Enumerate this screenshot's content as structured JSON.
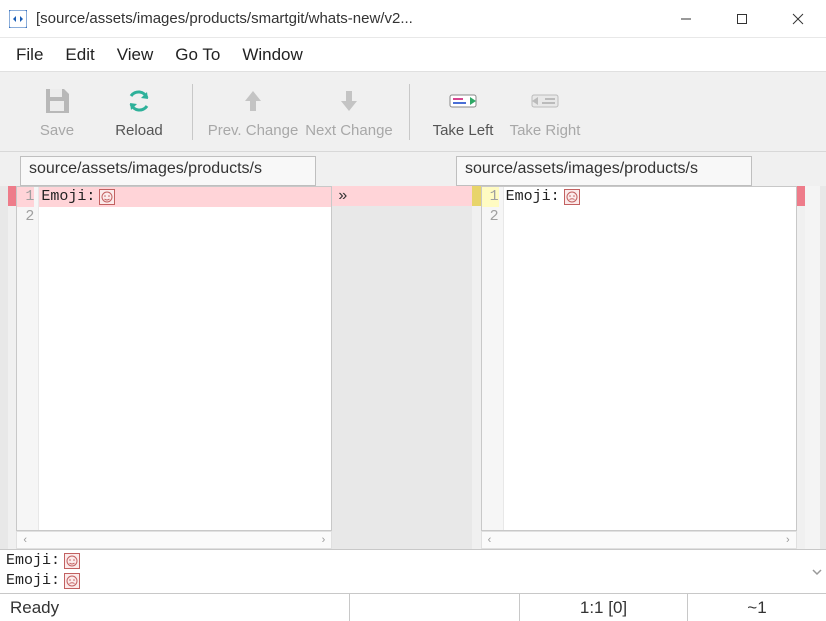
{
  "window": {
    "title": "[source/assets/images/products/smartgit/whats-new/v2..."
  },
  "menubar": {
    "items": [
      "File",
      "Edit",
      "View",
      "Go To",
      "Window"
    ]
  },
  "toolbar": {
    "save": "Save",
    "reload": "Reload",
    "prev": "Prev. Change",
    "next": "Next Change",
    "take_left": "Take Left",
    "take_right": "Take Right"
  },
  "paths": {
    "left": "source/assets/images/products/s",
    "right": "source/assets/images/products/s"
  },
  "diff": {
    "left": {
      "lines": [
        {
          "n": "1",
          "text": "Emoji:",
          "emoji_color": "#c26060",
          "changed": true
        },
        {
          "n": "2",
          "text": "",
          "changed": false
        }
      ]
    },
    "right": {
      "lines": [
        {
          "n": "1",
          "text": "Emoji:",
          "emoji_color": "#c26060",
          "changed": true
        },
        {
          "n": "2",
          "text": "",
          "changed": false
        }
      ]
    },
    "connector_glyph": "»"
  },
  "merged": {
    "lines": [
      {
        "text": "Emoji:",
        "emoji_color": "#c26060"
      },
      {
        "text": "Emoji:",
        "emoji_color": "#c26060"
      }
    ]
  },
  "status": {
    "left": "Ready",
    "mid": "",
    "pos": "1:1 [0]",
    "diff": "~1"
  }
}
